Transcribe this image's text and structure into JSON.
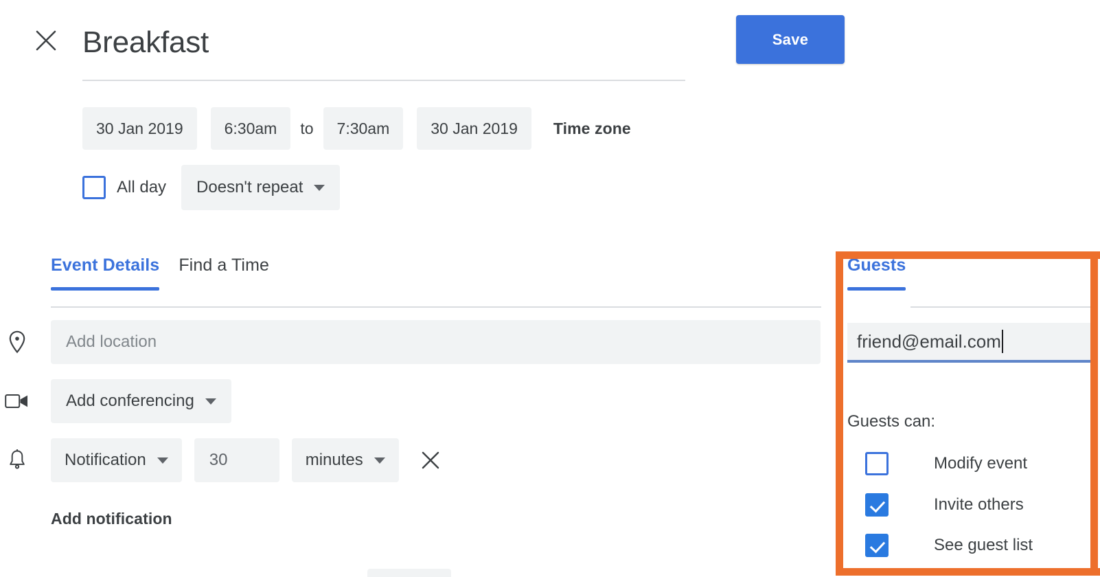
{
  "header": {
    "close_icon": "close-icon",
    "title": "Breakfast",
    "save_label": "Save",
    "accent_blue": "#3b72dc"
  },
  "schedule": {
    "start_date": "30 Jan 2019",
    "start_time": "6:30am",
    "to_label": "to",
    "end_time": "7:30am",
    "end_date": "30 Jan 2019",
    "time_zone_label": "Time zone",
    "all_day_label": "All day",
    "all_day_checked": false,
    "repeat_label": "Doesn't repeat"
  },
  "tabs": [
    {
      "label": "Event Details",
      "active": true
    },
    {
      "label": "Find a Time",
      "active": false
    }
  ],
  "details": {
    "location": {
      "icon": "location-pin-icon",
      "value": "",
      "placeholder": "Add location"
    },
    "conferencing": {
      "icon": "video-camera-icon",
      "label": "Add conferencing"
    },
    "notification": {
      "icon": "bell-icon",
      "type": "Notification",
      "amount": "30",
      "unit": "minutes",
      "remove_icon": "close-icon"
    },
    "add_notification_label": "Add notification"
  },
  "guests": {
    "tab_label": "Guests",
    "highlight_color": "#ed6f2c",
    "input_value": "friend@email.com",
    "permissions_label": "Guests can:",
    "permissions": [
      {
        "label": "Modify event",
        "checked": false
      },
      {
        "label": "Invite others",
        "checked": true
      },
      {
        "label": "See guest list",
        "checked": true
      }
    ]
  }
}
